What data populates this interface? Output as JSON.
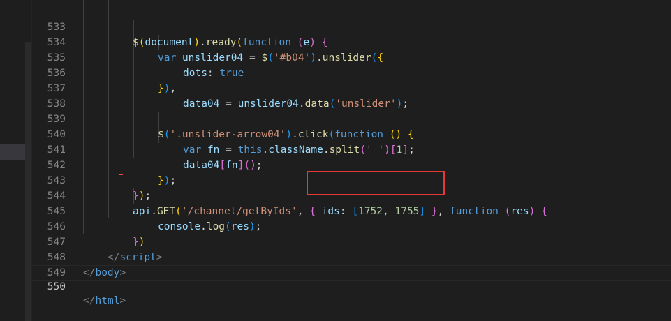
{
  "editor": {
    "lines": [
      {
        "num": "533"
      },
      {
        "num": "534"
      },
      {
        "num": "535"
      },
      {
        "num": "536"
      },
      {
        "num": "537"
      },
      {
        "num": "538"
      },
      {
        "num": "539"
      },
      {
        "num": "540"
      },
      {
        "num": "541"
      },
      {
        "num": "542"
      },
      {
        "num": "543"
      },
      {
        "num": "544"
      },
      {
        "num": "545"
      },
      {
        "num": "546"
      },
      {
        "num": "547"
      },
      {
        "num": "548"
      },
      {
        "num": "549"
      },
      {
        "num": "550"
      }
    ],
    "tokens": {
      "l533": [
        "$",
        "(",
        "document",
        ")",
        ".",
        "ready",
        "(",
        "function",
        " ",
        "(",
        "e",
        ")",
        " ",
        "{"
      ],
      "l534": [
        "var",
        " ",
        "unslider04",
        " = ",
        "$",
        "(",
        "'#b04'",
        ")",
        ".",
        "unslider",
        "(",
        "{"
      ],
      "l535": [
        "dots",
        ": ",
        "true"
      ],
      "l536": [
        "}",
        ")",
        ","
      ],
      "l537": [
        "data04",
        " = ",
        "unslider04",
        ".",
        "data",
        "(",
        "'unslider'",
        ")",
        ";"
      ],
      "l539": [
        "$",
        "(",
        "'.unslider-arrow04'",
        ")",
        ".",
        "click",
        "(",
        "function",
        " ",
        "(",
        ")",
        " ",
        "{"
      ],
      "l540": [
        "var",
        " ",
        "fn",
        " = ",
        "this",
        ".",
        "className",
        ".",
        "split",
        "(",
        "' '",
        ")",
        "[",
        "1",
        "]",
        ";"
      ],
      "l541": [
        "data04",
        "[",
        "fn",
        "]",
        "(",
        ")",
        ";"
      ],
      "l542": [
        "}",
        ")",
        ";"
      ],
      "l543": [
        "}",
        ")",
        ";"
      ],
      "l544": [
        "api",
        ".",
        "GET",
        "(",
        "'/channel/getByIds'",
        ", ",
        "{",
        " ",
        "ids",
        ": ",
        "[",
        "1752",
        ", ",
        "1755",
        "]",
        " ",
        "}",
        ", ",
        "function",
        " ",
        "(",
        "res",
        ")",
        " ",
        "{"
      ],
      "l545": [
        "console",
        ".",
        "log",
        "(",
        "res",
        ")",
        ";"
      ],
      "l546": [
        "}",
        ")"
      ],
      "l547": [
        "</",
        "script",
        ">"
      ],
      "l548": [
        "</",
        "body",
        ">"
      ],
      "l550": [
        "</",
        "html",
        ">"
      ]
    }
  },
  "colors": {
    "background": "#1e1e1e",
    "highlight_box": "#e53935",
    "keyword": "#569cd6",
    "string": "#ce9178",
    "number": "#b5cea8"
  }
}
